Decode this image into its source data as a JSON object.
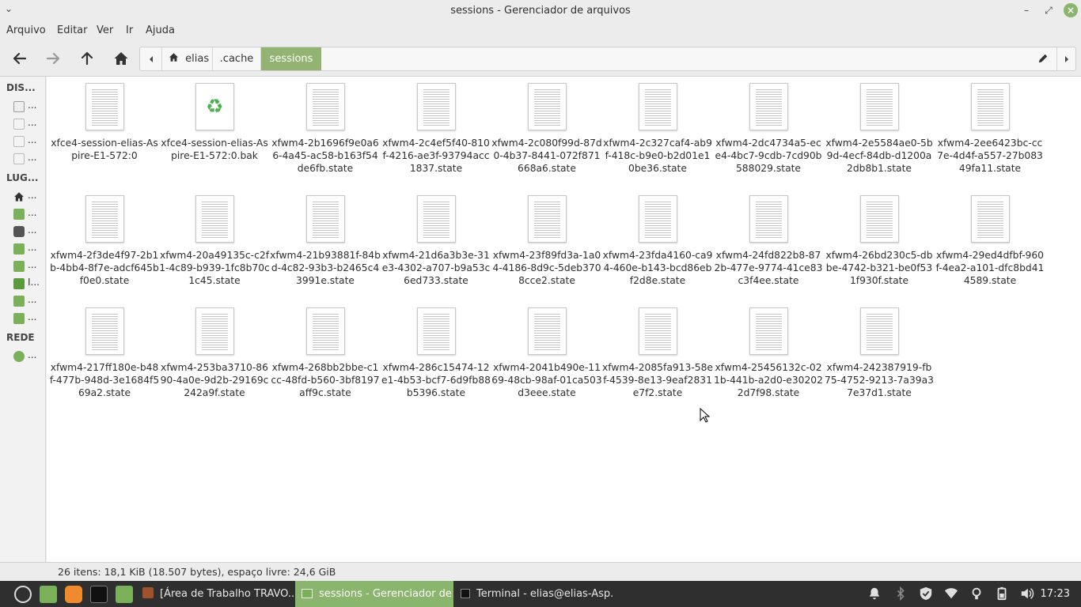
{
  "window": {
    "title": "sessions - Gerenciador de arquivos",
    "menu_glyph": "⌄",
    "minimize": "–",
    "maximize": "⤢",
    "close": "×"
  },
  "menu": [
    "Arquivo",
    "Editar",
    "Ver",
    "Ir",
    "Ajuda"
  ],
  "path": {
    "segments": [
      "elias",
      ".cache",
      "sessions"
    ],
    "active": "sessions"
  },
  "sidebar": {
    "devices_header": "DIS...",
    "places_header": "LUG...",
    "network_header": "REDE",
    "devices": [
      "...",
      "...",
      "...",
      "..."
    ],
    "places": [
      "...",
      "...",
      "...",
      "...",
      "...",
      "I...",
      "...",
      "..."
    ],
    "network": [
      "..."
    ]
  },
  "files": [
    {
      "name": "xfce4-session-elias-Aspire-E1-572:0",
      "type": "text"
    },
    {
      "name": "xfce4-session-elias-Aspire-E1-572:0.bak",
      "type": "recycle"
    },
    {
      "name": "xfwm4-2b1696f9e0a66-4a45-ac58-b163f54de6fb.state",
      "type": "text"
    },
    {
      "name": "xfwm4-2c4ef5f40-810f-4216-ae3f-93794acc1837.state",
      "type": "text"
    },
    {
      "name": "xfwm4-2c080f99d-87d0-4b37-8441-072f871668a6.state",
      "type": "text"
    },
    {
      "name": "xfwm4-2c327caf4-ab9f-418c-b9e0-b2d01e10be36.state",
      "type": "text"
    },
    {
      "name": "xfwm4-2dc4734a5-ece4-4bc7-9cdb-7cd90b588029.state",
      "type": "text"
    },
    {
      "name": "xfwm4-2e5584ae0-5b9d-4ecf-84db-d1200a2db8b1.state",
      "type": "text"
    },
    {
      "name": "xfwm4-2ee6423bc-cc7e-4d4f-a557-27b08349fa11.state",
      "type": "text"
    },
    {
      "name": "xfwm4-2f3de4f97-2b1b-4bb4-8f7e-adcf645bf0e0.state",
      "type": "text"
    },
    {
      "name": "xfwm4-20a49135c-c2f1-4c89-b939-1fc8b70c1c45.state",
      "type": "text"
    },
    {
      "name": "xfwm4-21b93881f-84bd-4c82-93b3-b2465c43991e.state",
      "type": "text"
    },
    {
      "name": "xfwm4-21d6a3b3e-31e3-4302-a707-b9a53c6ed733.state",
      "type": "text"
    },
    {
      "name": "xfwm4-23f89fd3a-1a04-4186-8d9c-5deb3708cce2.state",
      "type": "text"
    },
    {
      "name": "xfwm4-23fda4160-ca94-460e-b143-bcd86ebf2d8e.state",
      "type": "text"
    },
    {
      "name": "xfwm4-24fd822b8-872b-477e-9774-41ce83c3f4ee.state",
      "type": "text"
    },
    {
      "name": "xfwm4-26bd230c5-dbbe-4742-b321-be0f531f930f.state",
      "type": "text"
    },
    {
      "name": "xfwm4-29ed4dfbf-960f-4ea2-a101-dfc8bd414589.state",
      "type": "text"
    },
    {
      "name": "xfwm4-217ff180e-b48f-477b-948d-3e1684f569a2.state",
      "type": "text"
    },
    {
      "name": "xfwm4-253ba3710-8690-4a0e-9d2b-29169c242a9f.state",
      "type": "text"
    },
    {
      "name": "xfwm4-268bb2bbe-c1cc-48fd-b560-3bf8197aff9c.state",
      "type": "text"
    },
    {
      "name": "xfwm4-286c15474-12e1-4b53-bcf7-6d9fb88b5396.state",
      "type": "text"
    },
    {
      "name": "xfwm4-2041b490e-1169-48cb-98af-01ca503d3eee.state",
      "type": "text"
    },
    {
      "name": "xfwm4-2085fa913-58ef-4539-8e13-9eaf2831e7f2.state",
      "type": "text"
    },
    {
      "name": "xfwm4-25456132c-021b-441b-a2d0-e302022d7f98.state",
      "type": "text"
    },
    {
      "name": "xfwm4-242387919-fb75-4752-9213-7a39a37e37d1.state",
      "type": "text"
    }
  ],
  "status": "26 itens: 18,1 KiB (18.507 bytes), espaço livre: 24,6 GiB",
  "taskbar": {
    "windows": [
      "[Área de Trabalho TRAVO...",
      "sessions - Gerenciador de ...",
      "Terminal - elias@elias-Asp..."
    ],
    "active_index": 1,
    "clock": "17:23"
  },
  "colors": {
    "accent": "#8ab56c",
    "pathbar_active": "#92b372",
    "taskbar_bg": "#2f2f2f"
  }
}
